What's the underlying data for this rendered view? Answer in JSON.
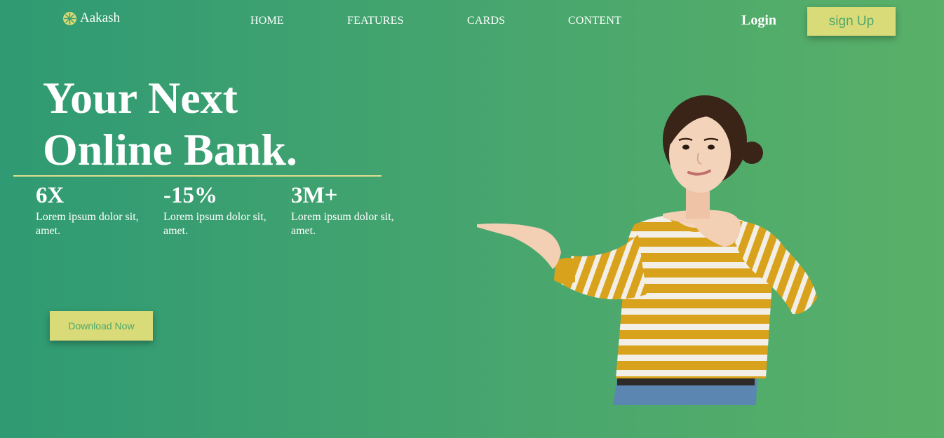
{
  "nav": {
    "brand": "Aakash",
    "links": [
      "HOME",
      "FEATURES",
      "CARDS",
      "CONTENT"
    ],
    "login": "Login",
    "signup": "sign Up"
  },
  "hero": {
    "title_line1": "Your Next",
    "title_line2": "Online Bank.",
    "stats": [
      {
        "value": "6X",
        "desc": "Lorem ipsum dolor sit, amet."
      },
      {
        "value": "-15%",
        "desc": "Lorem ipsum dolor sit, amet."
      },
      {
        "value": "3M+",
        "desc": "Lorem ipsum dolor sit, amet."
      }
    ],
    "download": "Download Now"
  },
  "colors": {
    "accent": "#d9da78",
    "accent_text": "#4ea86b",
    "bg_start": "#2f9a73",
    "bg_end": "#59b068"
  }
}
